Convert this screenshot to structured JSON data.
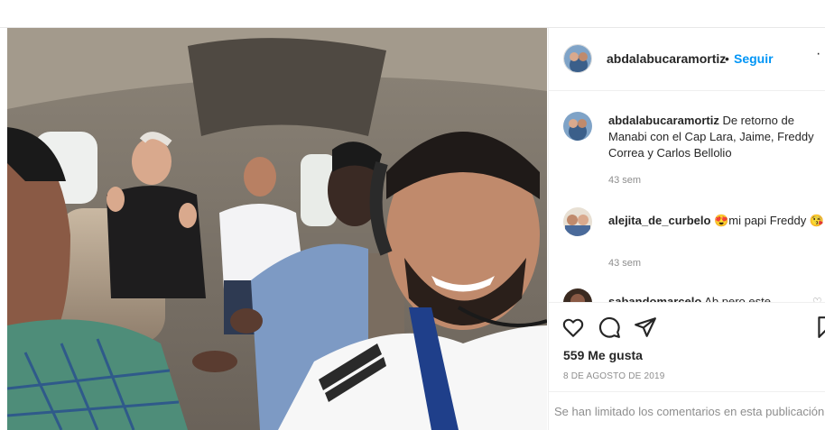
{
  "post": {
    "photo_icon": "selfie-photo",
    "author": "abdalabucaramortiz",
    "separator": "•",
    "follow_label": "Seguir",
    "more_icon": "more-horizontal-icon",
    "more_label": "·",
    "caption": {
      "username": "abdalabucaramortiz",
      "text": "De retorno de Manabi con el Cap Lara, Jaime, Freddy Correa y Carlos Bellolio",
      "time": "43 sem"
    },
    "comments": [
      {
        "username": "alejita_de_curbelo",
        "emoji_before": "😍",
        "text": "mi papi Freddy",
        "emoji_after": "😘",
        "time": "43 sem",
        "like_icon": "heart-outline-icon",
        "like_label": "♡"
      },
      {
        "username": "sabandomarcelo",
        "text": "Ab pero este",
        "like_icon": "heart-outline-icon",
        "like_label": "♡"
      }
    ],
    "actions": {
      "like_icon": "heart-outline-icon",
      "comment_icon": "comment-icon",
      "share_icon": "send-icon",
      "save_icon": "bookmark-icon"
    },
    "likes": "559 Me gusta",
    "date": "8 DE AGOSTO DE 2019",
    "comments_limited": "Se han limitado los comentarios en esta publicación"
  },
  "colors": {
    "accent": "#0095f6",
    "text": "#262626",
    "muted": "#8e8e8e",
    "border": "#efefef"
  }
}
